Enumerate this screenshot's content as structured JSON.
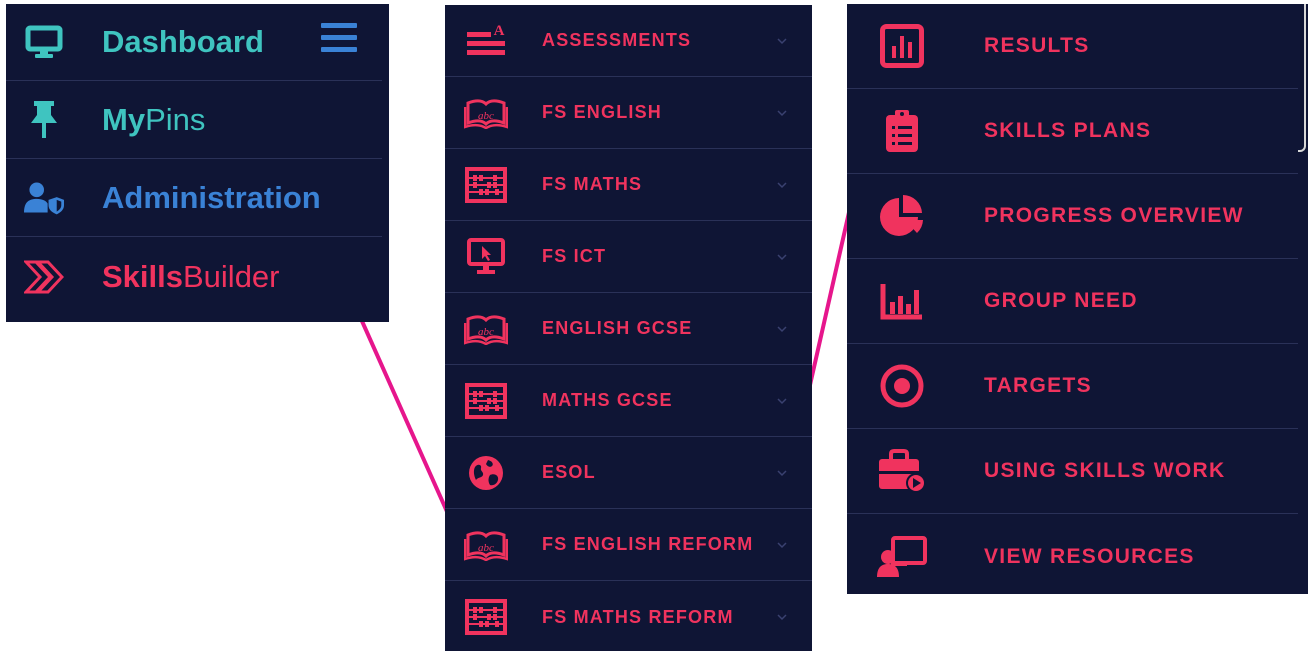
{
  "colors": {
    "panel_bg": "#0f1535",
    "teal": "#3fc4c0",
    "blue": "#3a82d6",
    "red": "#f0335e",
    "connector": "#e6168c"
  },
  "main_menu": {
    "items": [
      {
        "label_bold": "Dashboard",
        "label_thin": "",
        "icon": "monitor-icon",
        "color": "#3fc4c0"
      },
      {
        "label_bold": "My",
        "label_thin": "Pins",
        "icon": "pin-icon",
        "color": "#3fc4c0"
      },
      {
        "label_bold": "Administration",
        "label_thin": "",
        "icon": "user-shield-icon",
        "color": "#3a82d6"
      },
      {
        "label_bold": "Skills",
        "label_thin": "Builder",
        "icon": "double-chevron-icon",
        "color": "#f0335e"
      }
    ],
    "hamburger_icon": "hamburger-icon"
  },
  "skills_menu": {
    "items": [
      {
        "label": "ASSESSMENTS",
        "icon": "assessment-icon"
      },
      {
        "label": "FS ENGLISH",
        "icon": "book-abc-icon"
      },
      {
        "label": "FS MATHS",
        "icon": "abacus-icon"
      },
      {
        "label": "FS ICT",
        "icon": "computer-cursor-icon"
      },
      {
        "label": "ENGLISH GCSE",
        "icon": "book-abc-icon"
      },
      {
        "label": "MATHS GCSE",
        "icon": "abacus-icon"
      },
      {
        "label": "ESOL",
        "icon": "globe-icon"
      },
      {
        "label": "FS ENGLISH REFORM",
        "icon": "book-abc-icon"
      },
      {
        "label": "FS MATHS REFORM",
        "icon": "abacus-icon"
      }
    ]
  },
  "submenu": {
    "items": [
      {
        "label": "RESULTS",
        "icon": "bar-chart-icon"
      },
      {
        "label": "SKILLS PLANS",
        "icon": "clipboard-list-icon"
      },
      {
        "label": "PROGRESS OVERVIEW",
        "icon": "pie-chart-icon"
      },
      {
        "label": "GROUP NEED",
        "icon": "column-chart-icon"
      },
      {
        "label": "TARGETS",
        "icon": "target-icon"
      },
      {
        "label": "USING SKILLS WORK",
        "icon": "toolbox-play-icon"
      },
      {
        "label": "VIEW RESOURCES",
        "icon": "presenter-icon"
      }
    ]
  }
}
